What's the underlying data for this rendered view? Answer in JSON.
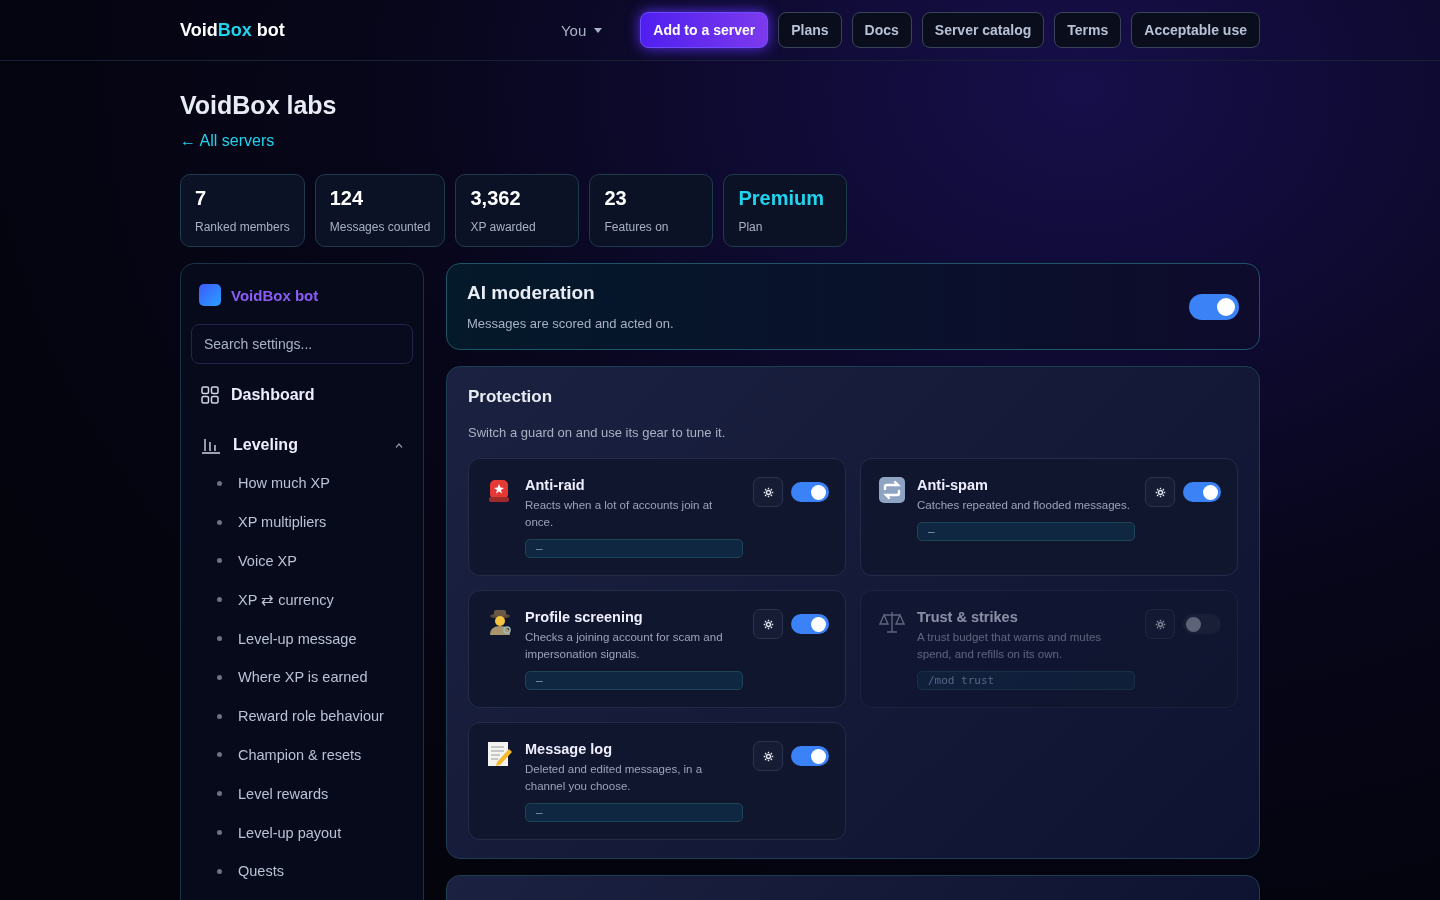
{
  "brand": {
    "parts": [
      {
        "text": "Void",
        "accent": false
      },
      {
        "text": "Box",
        "accent": true
      },
      {
        "text": " bot",
        "accent": false
      }
    ]
  },
  "nav": {
    "user": "You",
    "buttons": [
      {
        "label": "Add to a server",
        "kind": "primary"
      },
      {
        "label": "Plans",
        "kind": "outline"
      },
      {
        "label": "Docs",
        "kind": "outline"
      },
      {
        "label": "Server catalog",
        "kind": "outline"
      },
      {
        "label": "Terms",
        "kind": "outline"
      },
      {
        "label": "Acceptable use",
        "kind": "outline"
      }
    ]
  },
  "page": {
    "title": "VoidBox labs",
    "back_link": "← All servers"
  },
  "stats": [
    {
      "value": "7",
      "label": "Ranked members",
      "accent": false
    },
    {
      "value": "124",
      "label": "Messages counted",
      "accent": false
    },
    {
      "value": "3,362",
      "label": "XP awarded",
      "accent": false
    },
    {
      "value": "23",
      "label": "Features on",
      "accent": false
    },
    {
      "value": "Premium",
      "label": "Plan",
      "accent": true
    }
  ],
  "sidebar": {
    "title": "VoidBox bot",
    "search": {
      "placeholder": "Search settings..."
    },
    "items": [
      {
        "label": "Dashboard",
        "kind": "grid"
      },
      {
        "label": "Leveling",
        "kind": "chart",
        "expanded": true,
        "children": [
          {
            "label": "How much XP"
          },
          {
            "label": "XP multipliers"
          },
          {
            "label": "Voice XP"
          },
          {
            "label": "XP ⇄ currency"
          },
          {
            "label": "Level-up message"
          },
          {
            "label": "Where XP is earned"
          },
          {
            "label": "Reward role behaviour"
          },
          {
            "label": "Champion & resets"
          },
          {
            "label": "Level rewards"
          },
          {
            "label": "Level-up payout"
          },
          {
            "label": "Quests"
          }
        ]
      }
    ]
  },
  "ai_moderation": {
    "title": "AI moderation",
    "description": "Messages are scored and acted on.",
    "on": true
  },
  "protection": {
    "title": "Protection",
    "description": "Switch a guard on and use its gear to tune it.",
    "guards": [
      {
        "title": "Anti-raid",
        "description": "Reacts when a lot of accounts join at once.",
        "value": "—",
        "kind": "siren",
        "on": true,
        "disabled": false
      },
      {
        "title": "Anti-spam",
        "description": "Catches repeated and flooded messages.",
        "value": "—",
        "kind": "repeat",
        "on": true,
        "disabled": false
      },
      {
        "title": "Profile screening",
        "description": "Checks a joining account for scam and impersonation signals.",
        "value": "—",
        "kind": "detective",
        "on": true,
        "disabled": false
      },
      {
        "title": "Trust & strikes",
        "description": "A trust budget that warns and mutes spend, and refills on its own.",
        "value": "/mod trust",
        "kind": "scales",
        "on": false,
        "disabled": true
      },
      {
        "title": "Message log",
        "description": "Deleted and edited messages, in a channel you choose.",
        "value": "—",
        "kind": "memo",
        "on": true,
        "disabled": false
      }
    ]
  }
}
